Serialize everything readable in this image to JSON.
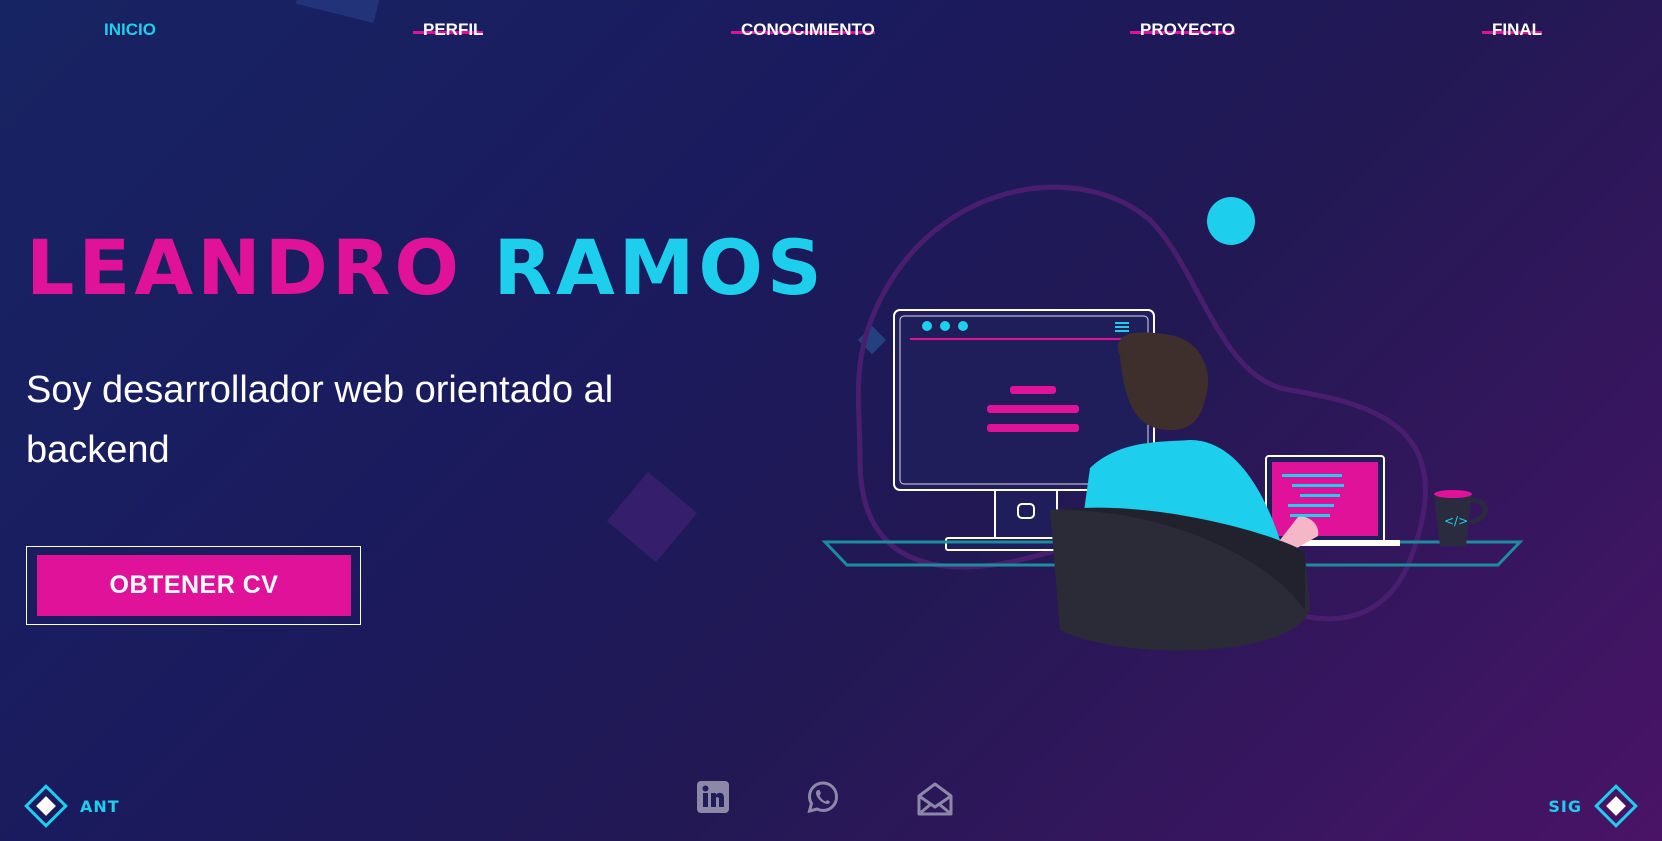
{
  "nav": {
    "items": [
      {
        "label": "INICIO",
        "active": true
      },
      {
        "label": "PERFIL",
        "active": false
      },
      {
        "label": "CONOCIMIENTO",
        "active": false
      },
      {
        "label": "PROYECTO",
        "active": false
      },
      {
        "label": "FINAL",
        "active": false
      }
    ]
  },
  "hero": {
    "first_name": "LEANDRO",
    "last_name": "RAMOS",
    "subtitle": "Soy desarrollador web orientado al backend",
    "cv_button": "OBTENER CV"
  },
  "controls": {
    "prev_label": "ANT",
    "next_label": "SIG"
  },
  "socials": [
    {
      "icon": "linkedin-icon"
    },
    {
      "icon": "whatsapp-icon"
    },
    {
      "icon": "email-icon"
    }
  ],
  "colors": {
    "accent_pink": "#e0129a",
    "accent_cyan": "#1ecfed",
    "background_start": "#172463",
    "background_end": "#4a1366"
  }
}
